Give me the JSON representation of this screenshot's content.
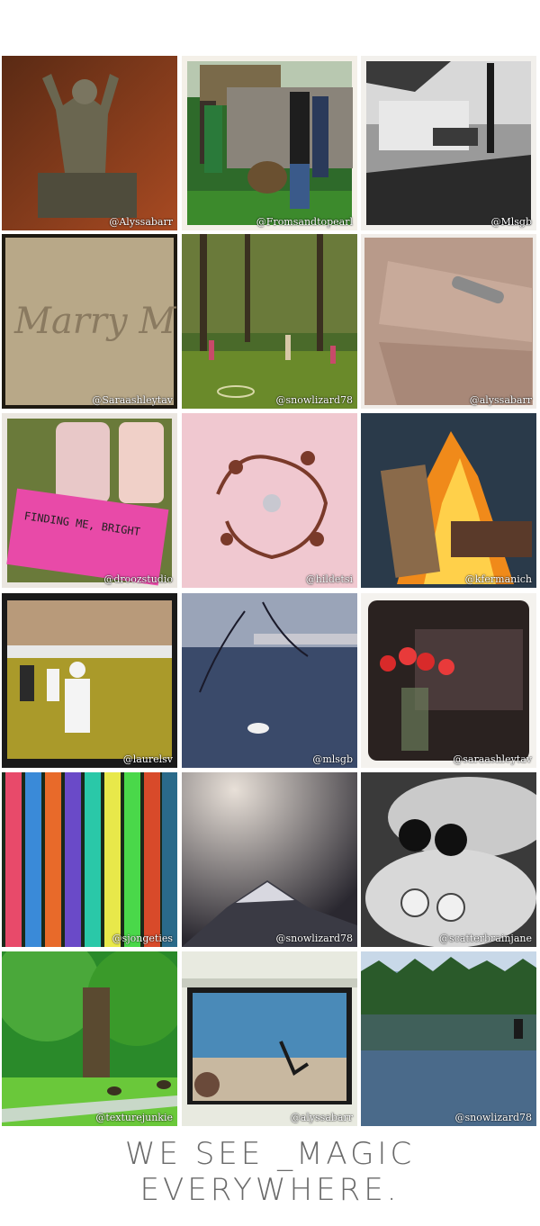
{
  "photos": [
    {
      "handle": "@Alyssabarr",
      "subject": "buddha-figurine"
    },
    {
      "handle": "@Fromsandtopearl",
      "subject": "men-planting-tree"
    },
    {
      "handle": "@Mlsgb",
      "subject": "street-bench"
    },
    {
      "handle": "@Saraashleytav",
      "subject": "sand-writing",
      "inline_text": "Marry Me?"
    },
    {
      "handle": "@snowlizard78",
      "subject": "backyard-hula-hoops"
    },
    {
      "handle": "@alyssabarr",
      "subject": "ring-on-hand"
    },
    {
      "handle": "@droozstudio",
      "subject": "book-and-bottles",
      "inline_text": "FINDING ME, BRIGHT"
    },
    {
      "handle": "@hildetsi",
      "subject": "ceiling-decal"
    },
    {
      "handle": "@kfermanich",
      "subject": "campfire"
    },
    {
      "handle": "@laurelsv",
      "subject": "kids-soccer"
    },
    {
      "handle": "@mlsgb",
      "subject": "swan-on-lake"
    },
    {
      "handle": "@saraashleytav",
      "subject": "red-roses-window"
    },
    {
      "handle": "@sjongeties",
      "subject": "colored-markers"
    },
    {
      "handle": "@snowlizard78",
      "subject": "mountain-sun-halo"
    },
    {
      "handle": "@scatterbrainjane",
      "subject": "couple-selfie"
    },
    {
      "handle": "@texturejunkie",
      "subject": "park-with-geese"
    },
    {
      "handle": "@alyssabarr",
      "subject": "beach-cartwheel"
    },
    {
      "handle": "@snowlizard78",
      "subject": "forest-lake"
    }
  ],
  "tagline": "WE SEE _MAGIC EVERYWHERE."
}
